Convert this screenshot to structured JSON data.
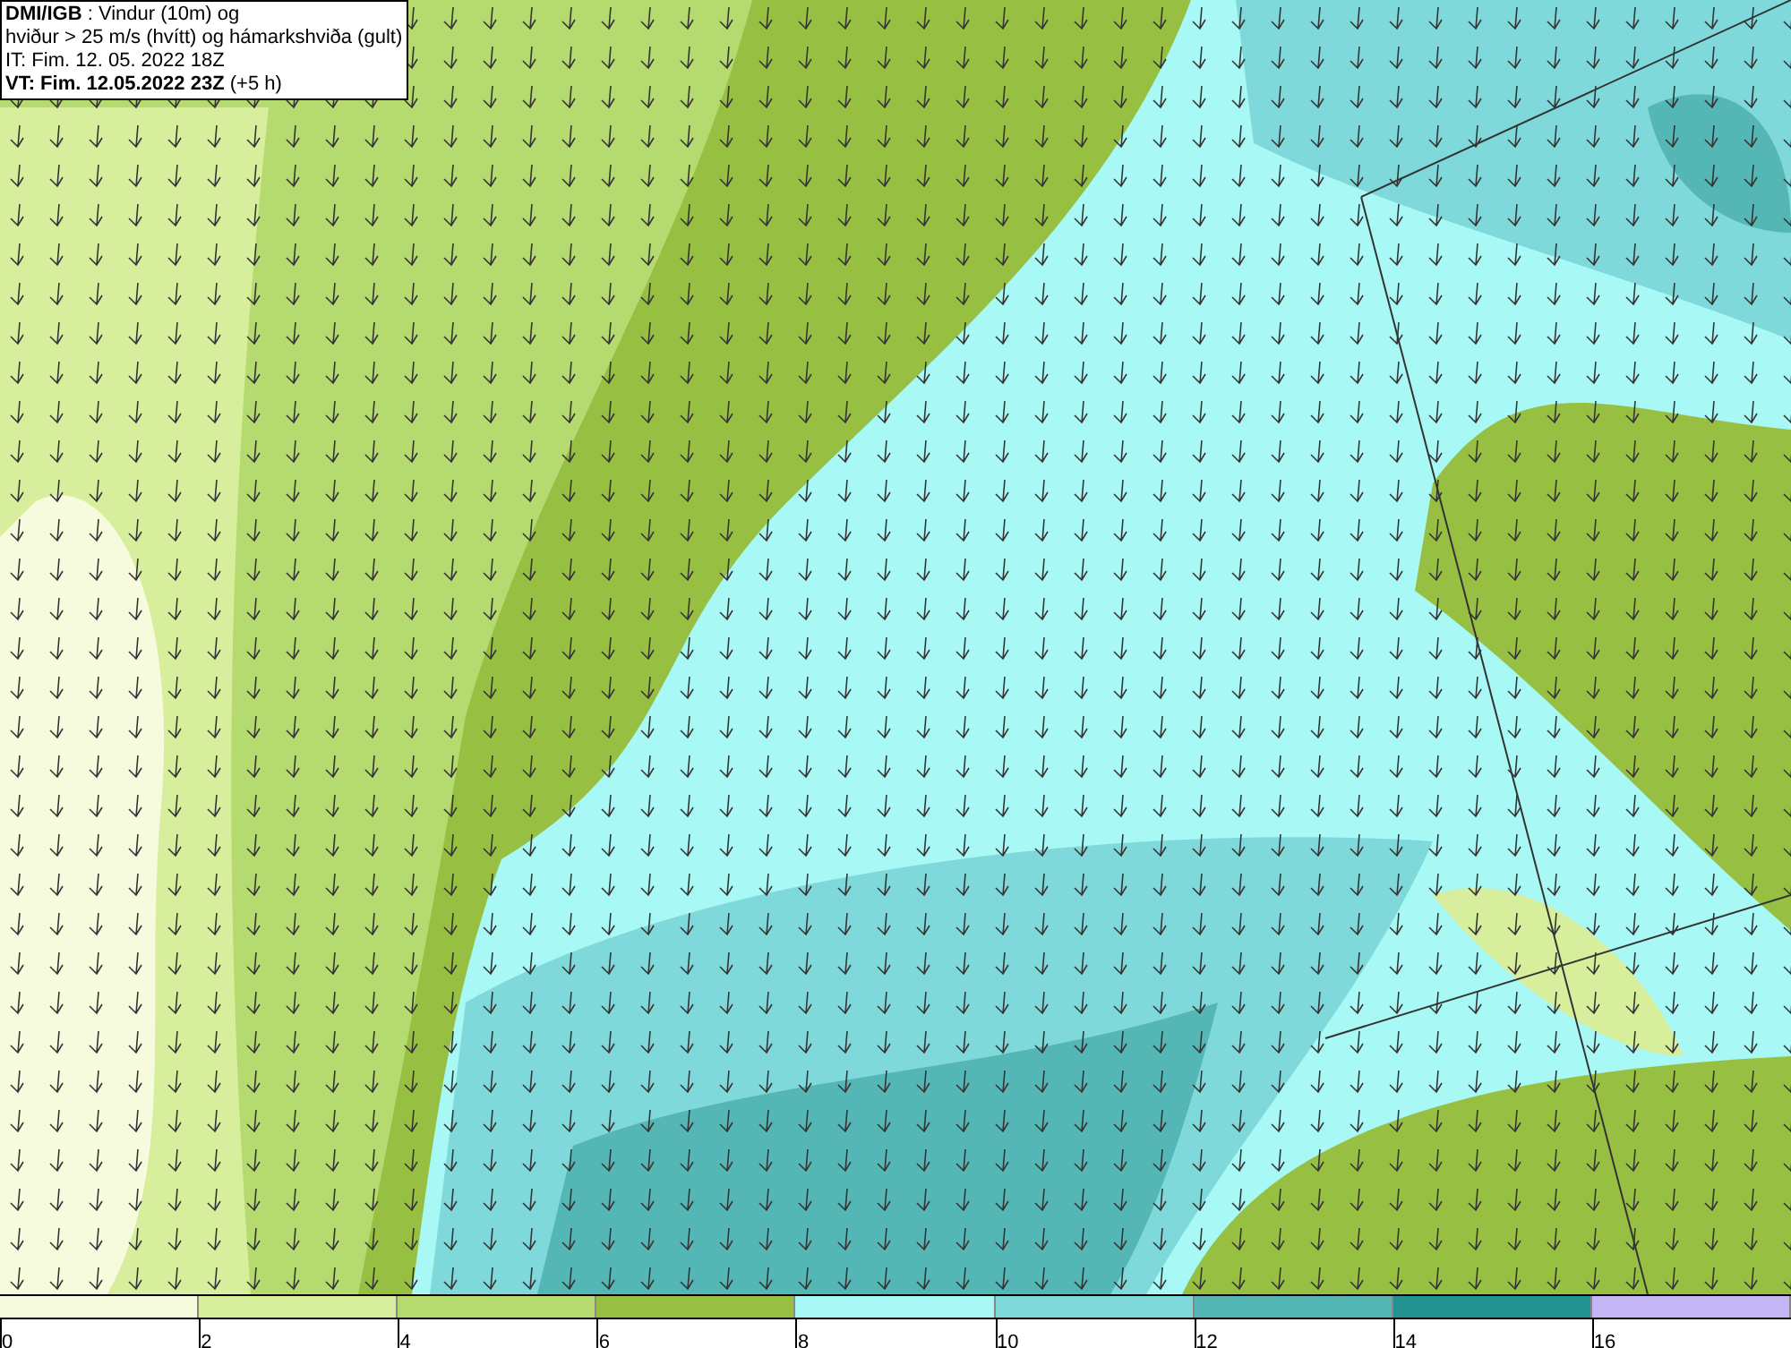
{
  "header": {
    "lines": [
      "**DMI/IGB** : Vindur (10m) og",
      "hviður > 25 m/s (hvítt) og hámarkshviða (gult)",
      "IT: Fim. 12. 05. 2022 18Z",
      "**VT: Fim. 12.05.2022 23Z** (+5 h)"
    ]
  },
  "colorbar": [
    {
      "color": "#f5fbdc",
      "label": "0"
    },
    {
      "color": "#d7ee9c",
      "label": "2"
    },
    {
      "color": "#b5da6f",
      "label": "4"
    },
    {
      "color": "#97c043",
      "label": "6"
    },
    {
      "color": "#a8f8f5",
      "label": "8"
    },
    {
      "color": "#7fd9da",
      "label": "10"
    },
    {
      "color": "#55b7b5",
      "label": "12"
    },
    {
      "color": "#229391",
      "label": "14"
    },
    {
      "color": "#c4b5f5",
      "label": "16"
    }
  ]
}
